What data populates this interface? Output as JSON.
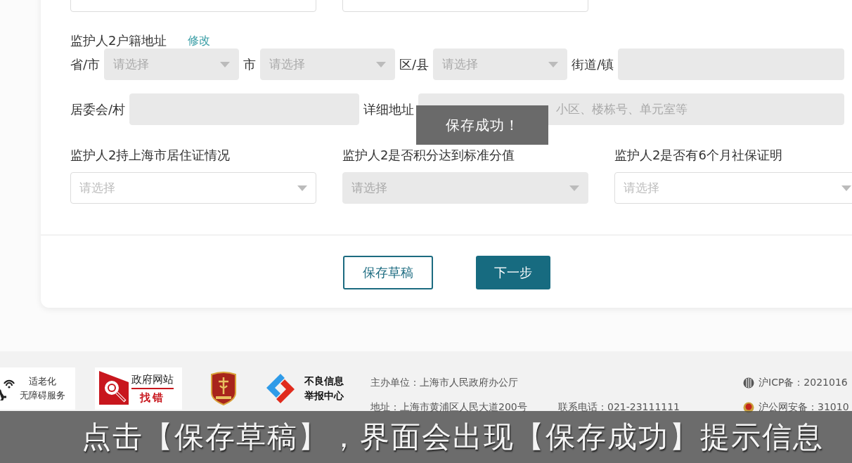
{
  "form": {
    "address": {
      "title": "监护人2户籍地址",
      "edit_link": "修改",
      "fields": [
        {
          "label": "省/市",
          "kind": "select",
          "placeholder": "请选择",
          "disabled": true
        },
        {
          "label": "市",
          "kind": "select",
          "placeholder": "请选择",
          "disabled": true
        },
        {
          "label": "区/县",
          "kind": "select",
          "placeholder": "请选择",
          "disabled": true
        },
        {
          "label": "街道/镇",
          "kind": "input",
          "disabled": true
        },
        {
          "label": "居委会/村",
          "kind": "input",
          "disabled": true
        },
        {
          "label": "详细地址",
          "kind": "input",
          "placeholder": "小区、楼栋号、单元室等",
          "disabled": true
        }
      ]
    },
    "questions": [
      {
        "label": "监护人2持上海市居住证情况",
        "placeholder": "请选择",
        "disabled": false
      },
      {
        "label": "监护人2是否积分达到标准分值",
        "placeholder": "请选择",
        "disabled": true
      },
      {
        "label": "监护人2是否有6个月社保证明",
        "placeholder": "请选择",
        "disabled": false
      }
    ],
    "buttons": [
      {
        "label": "保存草稿",
        "kind": "secondary"
      },
      {
        "label": "下一步",
        "kind": "primary"
      }
    ]
  },
  "toast": {
    "text": "保存成功！"
  },
  "footer": {
    "badges": [
      {
        "kind": "accessibility",
        "lines": [
          "适老化",
          "无障碍服务"
        ]
      },
      {
        "kind": "error-report",
        "lines": [
          "政府网站",
          "找错"
        ]
      },
      {
        "kind": "emblem"
      },
      {
        "kind": "report-center",
        "lines": [
          "不良信息",
          "举报中心"
        ]
      }
    ],
    "info": [
      [
        "主办单位：上海市人民政府办公厅"
      ],
      [
        "地址：上海市黄浦区人民大道200号",
        "联系电话：021-23111111"
      ]
    ],
    "records": [
      {
        "kind": "icp",
        "text": "沪ICP备：2021016"
      },
      {
        "kind": "police",
        "text": "沪公网安备：31010"
      }
    ]
  },
  "caption": "点击【保存草稿】，界面会出现【保存成功】提示信息"
}
